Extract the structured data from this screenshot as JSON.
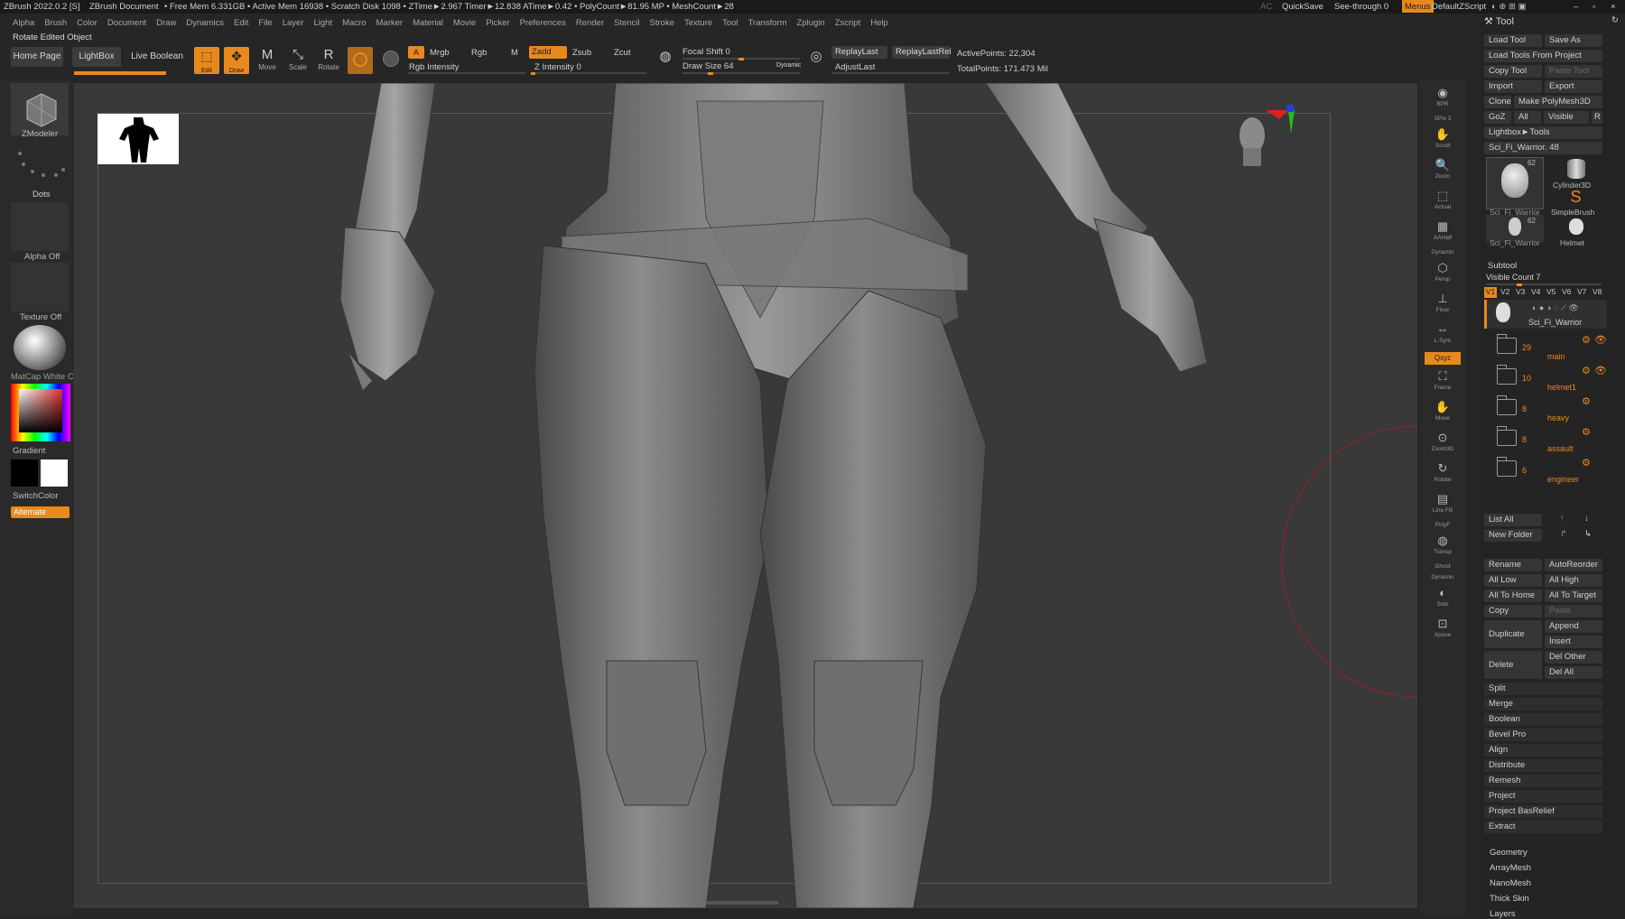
{
  "titlebar": {
    "app": "ZBrush 2022.0.2 [S]",
    "doc": "ZBrush Document",
    "stats": "• Free Mem 6.331GB • Active Mem 16938 • Scratch Disk 1098 • ZTime►2.967 Timer►12.838 ATime►0.42 • PolyCount►81.95 MP • MeshCount►28",
    "ac": "AC",
    "quicksave": "QuickSave",
    "seethrough": "See-through  0",
    "menus": "Menus",
    "script": "DefaultZScript"
  },
  "menu": [
    "Alpha",
    "Brush",
    "Color",
    "Document",
    "Draw",
    "Dynamics",
    "Edit",
    "File",
    "Layer",
    "Light",
    "Macro",
    "Marker",
    "Material",
    "Movie",
    "Picker",
    "Preferences",
    "Render",
    "Stencil",
    "Stroke",
    "Texture",
    "Tool",
    "Transform",
    "Zplugin",
    "Zscript",
    "Help"
  ],
  "status_message": "Rotate Edited Object",
  "toolbar": {
    "home": "Home Page",
    "lightbox": "LightBox",
    "liveboolean": "Live Boolean",
    "edit": "Edit",
    "draw": "Draw",
    "move": "Move",
    "scale": "Scale",
    "rotate": "Rotate",
    "a": "A",
    "mrgb": "Mrgb",
    "rgb": "Rgb",
    "m": "M",
    "zadd": "Zadd",
    "zsub": "Zsub",
    "zcut": "Zcut",
    "rgb_intensity": "Rgb Intensity",
    "z_intensity": "Z Intensity 0",
    "focal_shift": "Focal Shift 0",
    "draw_size": "Draw Size 64",
    "dynamic": "Dynamic",
    "replaylast": "ReplayLast",
    "replaylastrel": "ReplayLastRel",
    "adjustlast": "AdjustLast",
    "active_points": "ActivePoints: 22,304",
    "total_points": "TotalPoints: 171.473 Mil",
    "z_intensity_value": 0,
    "draw_size_value": 64
  },
  "left": {
    "zmodeler": "ZModeler",
    "dots": "Dots",
    "alpha": "Alpha Off",
    "texture": "Texture Off",
    "matcap": "MatCap White C",
    "gradient": "Gradient",
    "switchcolor": "SwitchColor",
    "alternate": "Alternate"
  },
  "right_shelf": [
    "BPR",
    "SPix 3",
    "Scroll",
    "Zoom",
    "Actual",
    "AAHalf",
    "Dynamic",
    "Persp",
    "Floor",
    "L.Sym",
    "Qxyz",
    "Frame",
    "Move",
    "Zoom3D",
    "Rotate",
    "Line Fill",
    "PolyF",
    "Transp",
    "Ghost",
    "Dynamic",
    "Solo",
    "Xpose"
  ],
  "tool": {
    "title": "Tool",
    "load_tool": "Load Tool",
    "save_as": "Save As",
    "load_from_project": "Load Tools From Project",
    "copy_tool": "Copy Tool",
    "paste_tool": "Paste Tool",
    "import": "Import",
    "export": "Export",
    "clone": "Clone",
    "make_polymesh": "Make PolyMesh3D",
    "goz": "GoZ",
    "all": "All",
    "visible": "Visible",
    "r": "R",
    "lightbox_tools": "Lightbox►Tools",
    "current": "Sci_Fi_Warrior. 48",
    "thumbs": [
      {
        "name": "Sci_Fi_Warrior",
        "count": "62"
      },
      {
        "name": "Cylinder3D",
        "count": ""
      },
      {
        "name": "SimpleBrush",
        "count": ""
      },
      {
        "name": "Sci_Fi_Warrior",
        "count": "62"
      },
      {
        "name": "Helmet",
        "count": ""
      }
    ]
  },
  "subtool": {
    "title": "Subtool",
    "visible_count": "Visible Count 7",
    "versions": [
      "V1",
      "V2",
      "V3",
      "V4",
      "V5",
      "V6",
      "V7",
      "V8"
    ],
    "active_name": "Sci_Fi_Warrior",
    "folders": [
      {
        "count": "29",
        "name": "main"
      },
      {
        "count": "10",
        "name": "helmet1"
      },
      {
        "count": "8",
        "name": "heavy"
      },
      {
        "count": "8",
        "name": "assault"
      },
      {
        "count": "6",
        "name": "engineer"
      }
    ],
    "list_all": "List All",
    "new_folder": "New Folder",
    "rename": "Rename",
    "autoreorder": "AutoReorder",
    "all_low": "All Low",
    "all_high": "All High",
    "all_to_home": "All To Home",
    "all_to_target": "All To Target",
    "copy": "Copy",
    "paste": "Paste",
    "duplicate": "Duplicate",
    "append": "Append",
    "insert": "Insert",
    "delete": "Delete",
    "del_other": "Del Other",
    "del_all": "Del All",
    "sections": [
      "Split",
      "Merge",
      "Boolean",
      "Bevel Pro",
      "Align",
      "Distribute",
      "Remesh",
      "Project",
      "Project BasRelief",
      "Extract"
    ]
  },
  "bottom_sections": [
    "Geometry",
    "ArrayMesh",
    "NanoMesh",
    "Thick Skin",
    "Layers"
  ],
  "colors": {
    "accent": "#e8891e",
    "bg": "#262626",
    "panel": "#242424",
    "canvas": "#393939"
  }
}
